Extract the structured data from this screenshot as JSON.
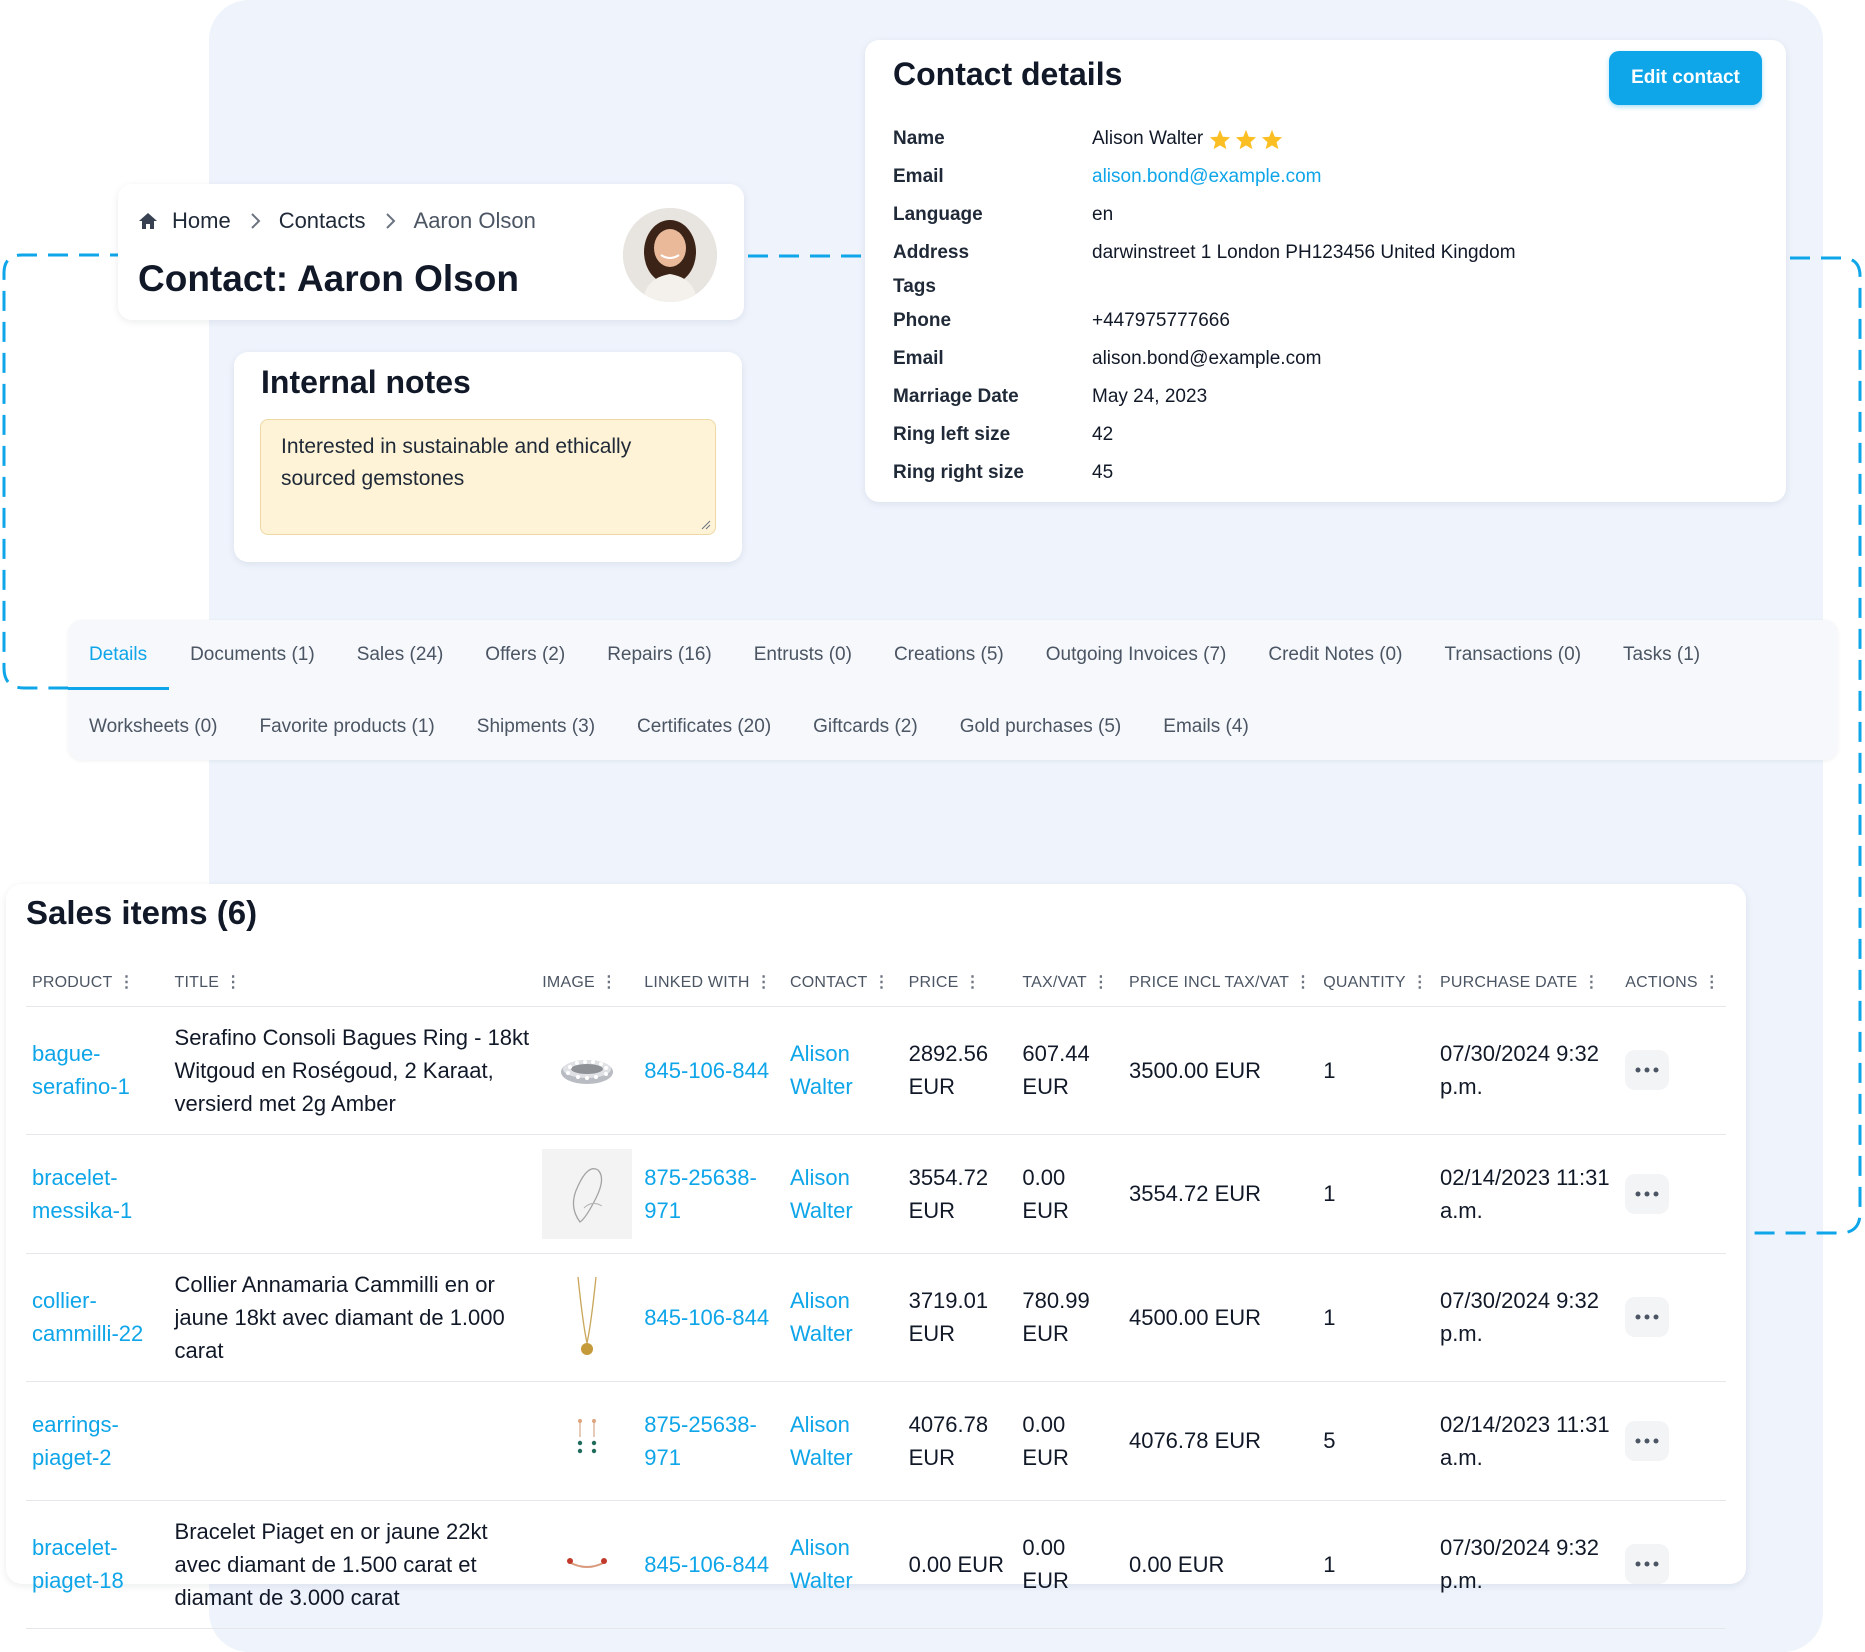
{
  "header": {
    "breadcrumb": {
      "home": "Home",
      "contacts": "Contacts",
      "current": "Aaron Olson"
    },
    "title": "Contact: Aaron Olson"
  },
  "notes": {
    "title": "Internal notes",
    "text": "Interested in sustainable and ethically sourced gemstones"
  },
  "contact": {
    "title": "Contact details",
    "edit_label": "Edit contact",
    "rating": 3,
    "star_color": "#fbbf24",
    "rows": [
      {
        "label": "Name",
        "value": "Alison Walter"
      },
      {
        "label": "Email",
        "value": "alison.bond@example.com"
      },
      {
        "label": "Language",
        "value": "en"
      },
      {
        "label": "Address",
        "value": "darwinstreet 1 London PH123456 United Kingdom"
      },
      {
        "label": "Tags",
        "value": ""
      },
      {
        "label": "Phone",
        "value": "+447975777666"
      },
      {
        "label": "Email",
        "value": "alison.bond@example.com"
      },
      {
        "label": "Marriage Date",
        "value": "May 24, 2023"
      },
      {
        "label": "Ring left size",
        "value": "42"
      },
      {
        "label": "Ring right size",
        "value": "45"
      }
    ]
  },
  "tabs": {
    "row1": [
      "Details",
      "Documents (1)",
      "Sales (24)",
      "Offers (2)",
      "Repairs (16)",
      "Entrusts (0)",
      "Creations (5)",
      "Outgoing Invoices (7)",
      "Credit Notes (0)",
      "Transactions (0)",
      "Tasks (1)"
    ],
    "row2": [
      "Worksheets (0)",
      "Favorite products (1)",
      "Shipments (3)",
      "Certificates (20)",
      "Giftcards (2)",
      "Gold purchases (5)",
      "Emails (4)"
    ],
    "active": "Details"
  },
  "sales": {
    "title": "Sales items (6)",
    "columns": [
      "PRODUCT",
      "TITLE",
      "IMAGE",
      "LINKED WITH",
      "CONTACT",
      "PRICE",
      "TAX/VAT",
      "PRICE INCL TAX/VAT",
      "QUANTITY",
      "PURCHASE DATE",
      "ACTIONS"
    ],
    "rows": [
      {
        "product": "bague-serafino-1",
        "title": "Serafino Consoli Bagues Ring - 18kt Witgoud en Roségoud, 2 Karaat, versierd met 2g Amber",
        "image": "ring-image",
        "linked": "845-106-844",
        "contact": "Alison Walter",
        "price": "2892.56 EUR",
        "tax": "607.44 EUR",
        "incl": "3500.00 EUR",
        "qty": "1",
        "date": "07/30/2024 9:32 p.m."
      },
      {
        "product": "bracelet-messika-1",
        "title": "",
        "image": "bracelet-sketch-image",
        "linked": "875-25638-971",
        "contact": "Alison Walter",
        "price": "3554.72 EUR",
        "tax": "0.00 EUR",
        "incl": "3554.72 EUR",
        "qty": "1",
        "date": "02/14/2023 11:31 a.m."
      },
      {
        "product": "collier-cammilli-22",
        "title": "Collier Annamaria Cammilli en or jaune 18kt avec diamant de 1.000 carat",
        "image": "necklace-image",
        "linked": "845-106-844",
        "contact": "Alison Walter",
        "price": "3719.01 EUR",
        "tax": "780.99 EUR",
        "incl": "4500.00 EUR",
        "qty": "1",
        "date": "07/30/2024 9:32 p.m."
      },
      {
        "product": "earrings-piaget-2",
        "title": "",
        "image": "earrings-image",
        "linked": "875-25638-971",
        "contact": "Alison Walter",
        "price": "4076.78 EUR",
        "tax": "0.00 EUR",
        "incl": "4076.78 EUR",
        "qty": "5",
        "date": "02/14/2023 11:31 a.m."
      },
      {
        "product": "bracelet-piaget-18",
        "title": "Bracelet Piaget en or jaune 22kt avec diamant de 1.500 carat et diamant de 3.000 carat",
        "image": "bangle-image",
        "linked": "845-106-844",
        "contact": "Alison Walter",
        "price": "0.00 EUR",
        "tax": "0.00 EUR",
        "incl": "0.00 EUR",
        "qty": "1",
        "date": "07/30/2024 9:32 p.m."
      }
    ]
  },
  "colors": {
    "accent": "#0ea5e9",
    "panel_bg": "#eef3fc",
    "notes_bg": "#fef3d6"
  }
}
